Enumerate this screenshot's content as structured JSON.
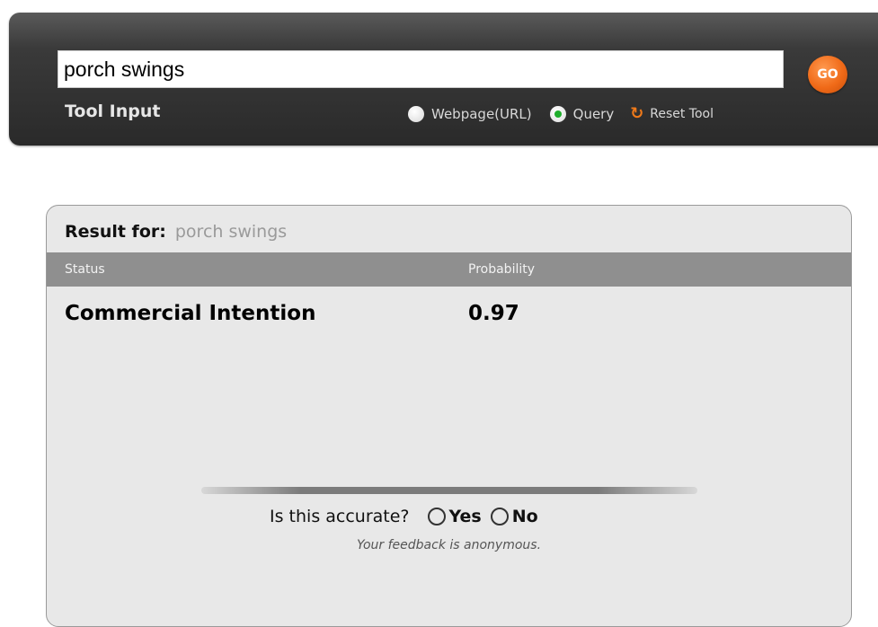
{
  "tool": {
    "query_value": "porch swings",
    "go_label": "GO",
    "input_label": "Tool Input",
    "options": [
      {
        "label": "Webpage(URL)",
        "selected": false
      },
      {
        "label": "Query",
        "selected": true
      }
    ],
    "reset_label": "Reset Tool",
    "reset_icon": "reset-arrow-icon",
    "accent_color": "#f06a18",
    "selected_color": "#1fae2c"
  },
  "result": {
    "label": "Result for:",
    "query": "porch swings",
    "columns": [
      "Status",
      "Probability"
    ],
    "rows": [
      {
        "status": "Commercial Intention",
        "probability": "0.97"
      }
    ]
  },
  "feedback": {
    "question": "Is this accurate?",
    "yes_label": "Yes",
    "no_label": "No",
    "note": "Your feedback is anonymous."
  }
}
